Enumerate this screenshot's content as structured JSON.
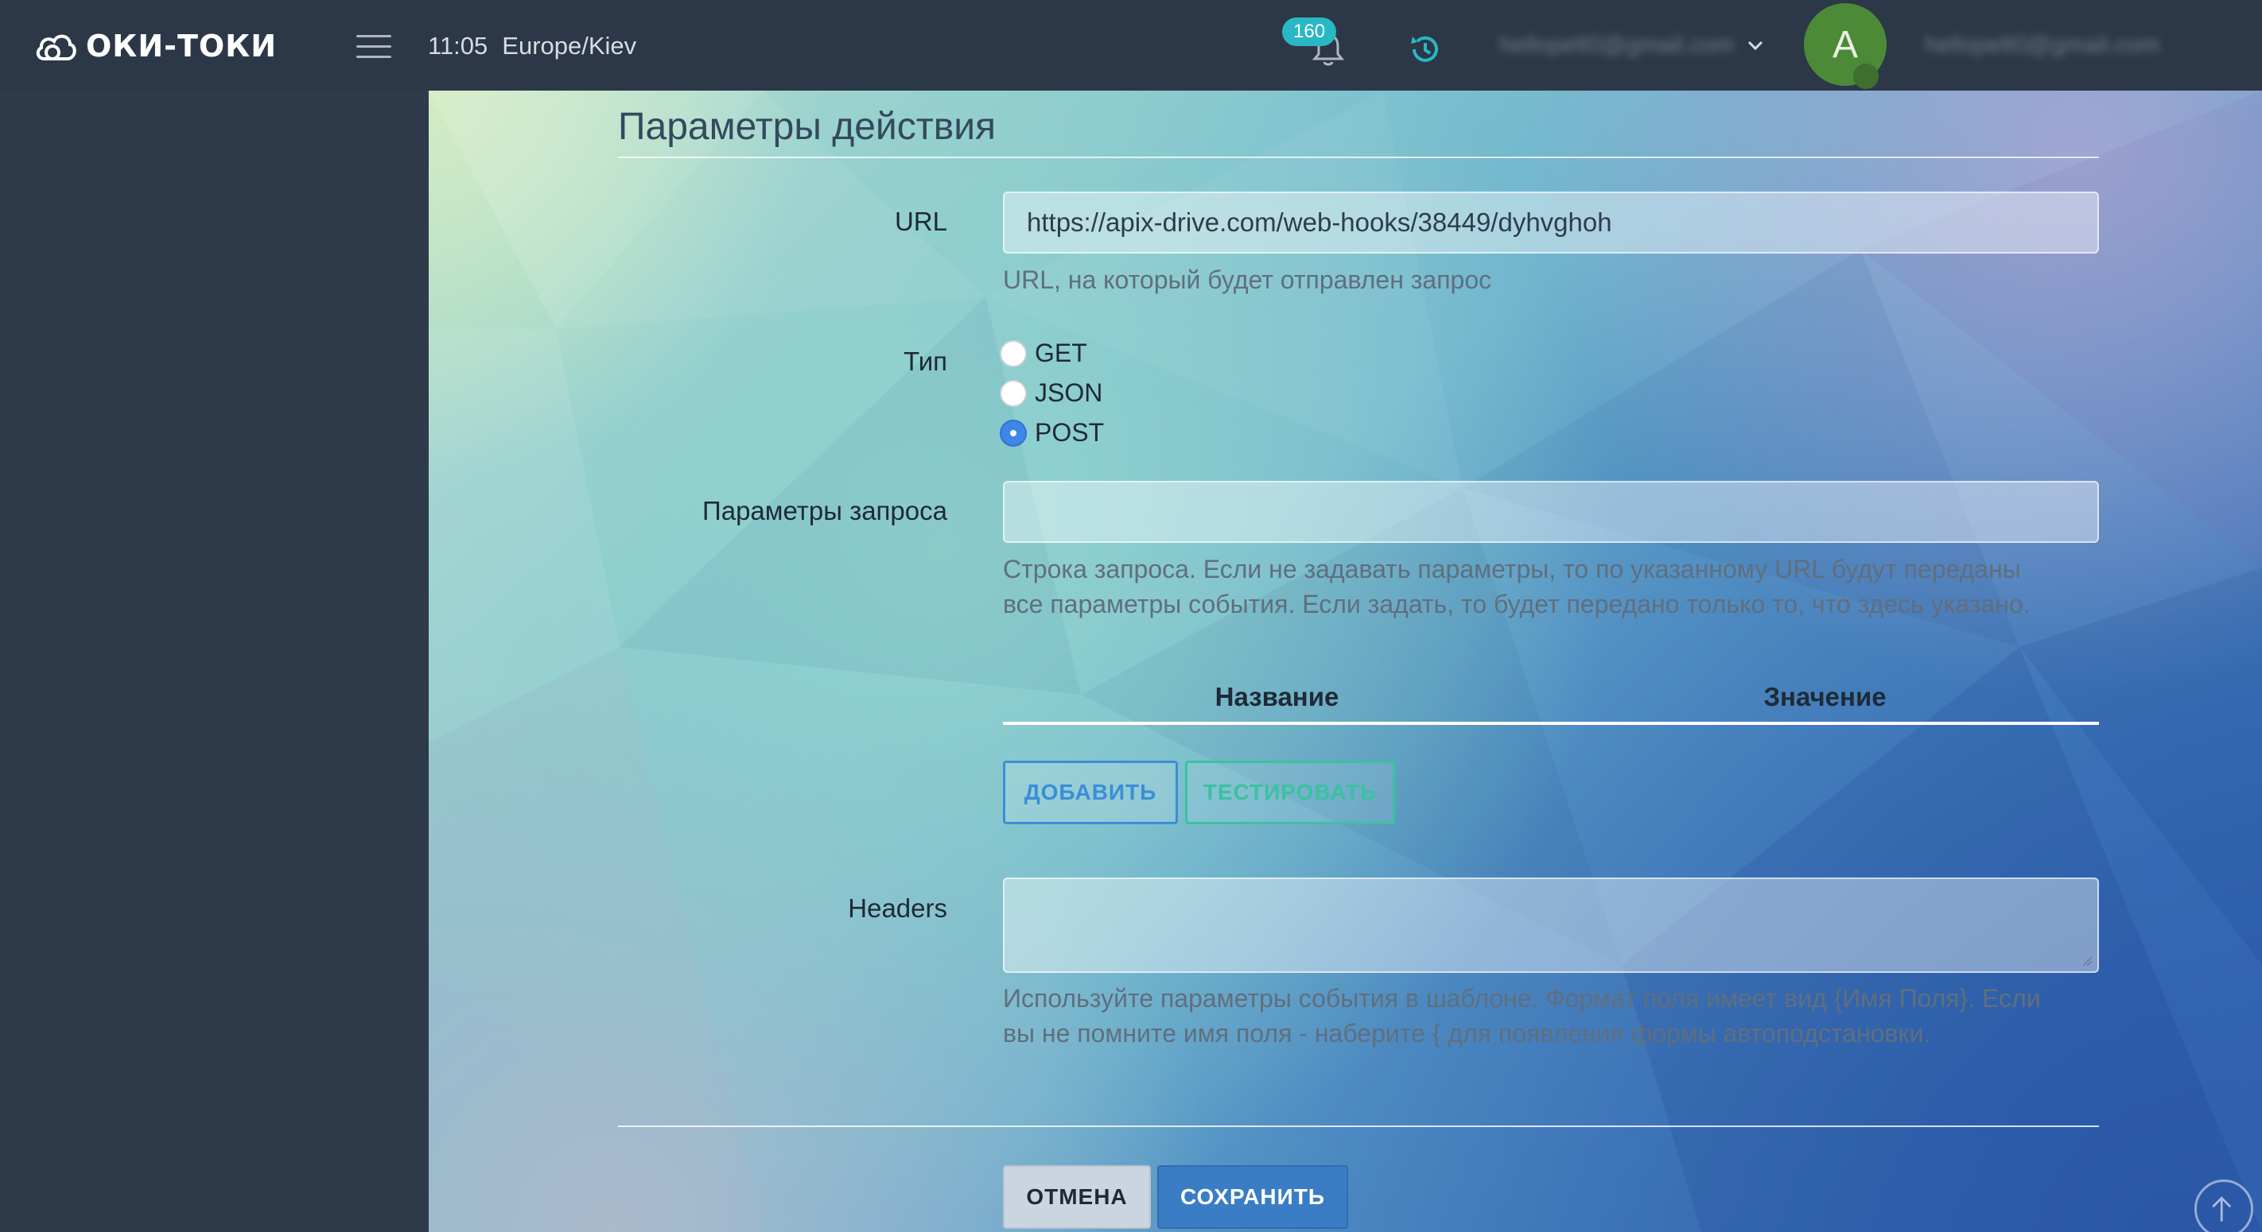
{
  "brand": {
    "name": "ОКИ-ТОКИ"
  },
  "header": {
    "time": "11:05",
    "timezone": "Europe/Kiev",
    "notifications_count": "160",
    "user_email": "hellopelt0@gmail.com",
    "avatar_letter": "A",
    "account_email": "hellopelt0@gmail.com"
  },
  "form": {
    "title": "Параметры действия",
    "url": {
      "label": "URL",
      "value": "https://apix-drive.com/web-hooks/38449/dyhvghoh",
      "hint": "URL, на который будет отправлен запрос"
    },
    "type": {
      "label": "Тип",
      "options": [
        "GET",
        "JSON",
        "POST"
      ],
      "selected": "POST"
    },
    "query_params": {
      "label": "Параметры запроса",
      "value": "",
      "hint_line1": "Строка запроса. Если не задавать параметры, то по указанному URL будут переданы",
      "hint_line2": "все параметры события. Если задать, то будет передано только то, что здесь указано."
    },
    "table": {
      "col_name": "Название",
      "col_value": "Значение"
    },
    "buttons": {
      "add": "ДОБАВИТЬ",
      "test": "ТЕСТИРОВАТЬ",
      "cancel": "ОТМЕНА",
      "save": "СОХРАНИТЬ"
    },
    "headers": {
      "label": "Headers",
      "value": "",
      "hint_line1": "Используйте параметры события в шаблоне. Формат поля имеет вид {Имя Поля}. Если",
      "hint_line2": "вы не помните имя поля - наберите { для появления формы автоподстановки."
    }
  },
  "colors": {
    "topbar": "#2c3848",
    "sidebar": "#2f3a4b",
    "primary": "#3a7dc5",
    "add_button": "#3b8ed8",
    "test_button": "#3ac2a0",
    "badge": "#2ab7c4",
    "avatar": "#4c8a38"
  }
}
